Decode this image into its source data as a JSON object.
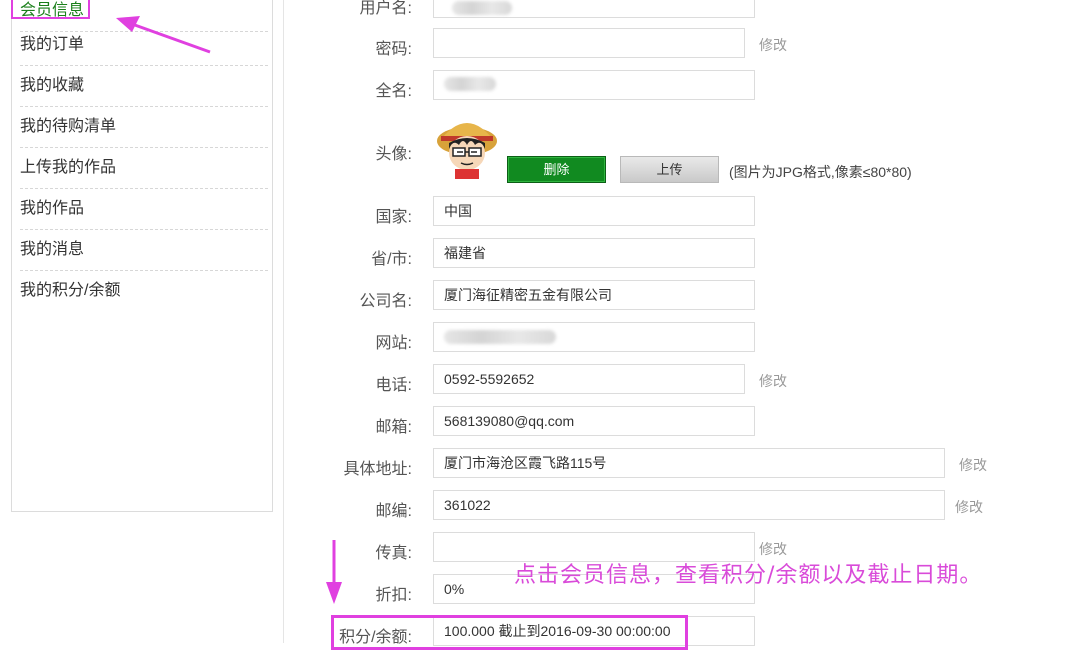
{
  "sidebar": {
    "items": [
      {
        "label": "会员信息"
      },
      {
        "label": "我的订单"
      },
      {
        "label": "我的收藏"
      },
      {
        "label": "我的待购清单"
      },
      {
        "label": "上传我的作品"
      },
      {
        "label": "我的作品"
      },
      {
        "label": "我的消息"
      },
      {
        "label": "我的积分/余额"
      }
    ]
  },
  "form": {
    "username_label": "用户名:",
    "password_label": "密码:",
    "fullname_label": "全名:",
    "avatar_label": "头像:",
    "delete_button": "删除",
    "upload_button": "上传",
    "avatar_hint": "(图片为JPG格式,像素≤80*80)",
    "country_label": "国家:",
    "country_value": "中国",
    "province_label": "省/市:",
    "province_value": "福建省",
    "company_label": "公司名:",
    "company_value": "厦门海征精密五金有限公司",
    "website_label": "网站:",
    "phone_label": "电话:",
    "phone_value": "0592-5592652",
    "email_label": "邮箱:",
    "email_value": "568139080@qq.com",
    "address_label": "具体地址:",
    "address_value": "厦门市海沧区霞飞路115号",
    "zip_label": "邮编:",
    "zip_value": "361022",
    "fax_label": "传真:",
    "discount_label": "折扣:",
    "discount_value": "0%",
    "points_label": "积分/余额:",
    "points_value": "100.000 截止到2016-09-30 00:00:00",
    "modify_label": "修改"
  },
  "annotation": "点击会员信息，查看积分/余额以及截止日期。",
  "colors": {
    "annotation": "#e040e0",
    "delete_button": "#118a20",
    "active_nav": "#1a7f1a"
  }
}
